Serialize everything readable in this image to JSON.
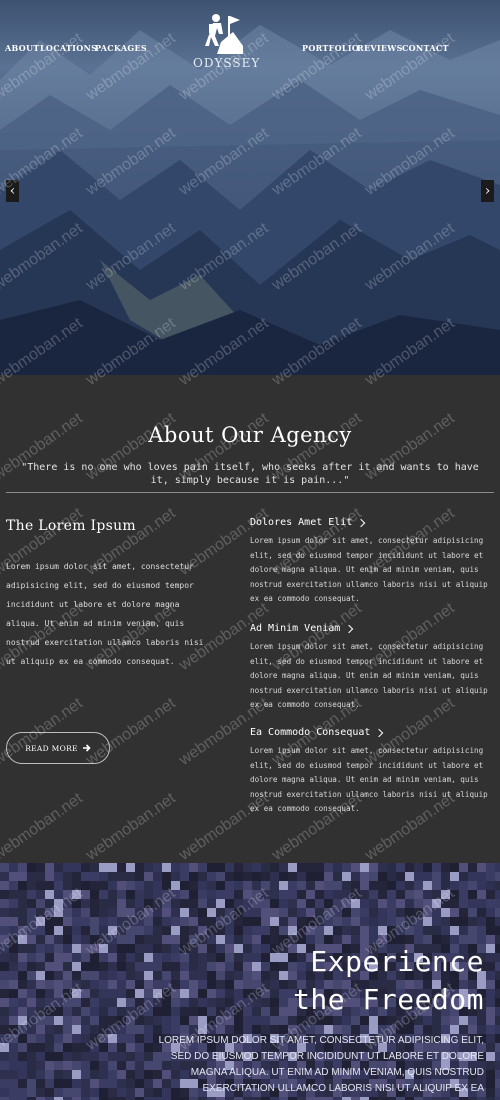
{
  "nav": {
    "left": [
      "ABOUT",
      "LOCATIONS",
      "PACKAGES"
    ],
    "right": [
      "PORTFOLIO",
      "REVIEWS",
      "CONTACT"
    ],
    "logo_text": "ODYSSEY",
    "logo_icon": "hiker-flag-icon"
  },
  "slider": {
    "prev_icon": "chevron-left-icon",
    "next_icon": "chevron-right-icon"
  },
  "about": {
    "title": "About Our Agency",
    "quote": "\"There is no one who loves pain itself, who seeks after it and wants to have it, simply because it is pain...\"",
    "left_heading": "The Lorem Ipsum",
    "left_paragraph": "Lorem ipsum dolor sit amet, consectetur adipisicing elit, sed do eiusmod tempor incididunt ut labore et dolore magna aliqua. Ut enim ad minim veniam, quis nostrud exercitation ullamco laboris nisi ut aliquip ex ea commodo consequat.",
    "read_more": "READ MORE",
    "features": [
      {
        "title": "Dolores Amet Elit",
        "text": "Lorem ipsum dolor sit amet, consectetur adipisicing elit, sed do eiusmod tempor incididunt ut labore et dolore magna aliqua. Ut enim ad minim veniam, quis nostrud exercitation ullamco laboris nisi ut aliquip ex ea commodo consequat."
      },
      {
        "title": "Ad Minim Veniam",
        "text": "Lorem ipsum dolor sit amet, consectetur adipisicing elit, sed do eiusmod tempor incididunt ut labore et dolore magna aliqua. Ut enim ad minim veniam, quis nostrud exercitation ullamco laboris nisi ut aliquip ex ea commodo consequat."
      },
      {
        "title": "Ea Commodo Consequat",
        "text": "Lorem ipsum dolor sit amet, consectetur adipisicing elit, sed do eiusmod tempor incididunt ut labore et dolore magna aliqua. Ut enim ad minim veniam, quis nostrud exercitation ullamco laboris nisi ut aliquip ex ea commodo consequat."
      }
    ]
  },
  "experience": {
    "title_line1": "Experience",
    "title_line2": "the Freedom",
    "text": "LOREM IPSUM DOLOR SIT AMET, CONSECTETUR ADIPISICING ELIT, SED DO EIUSMOD TEMPOR INCIDIDUNT UT LABORE ET DOLORE MAGNA ALIQUA. UT ENIM AD MINIM VENIAM, QUIS NOSTRUD EXERCITATION ULLAMCO LABORIS NISI UT ALIQUIP EX EA"
  },
  "watermark": "webmoban.net"
}
